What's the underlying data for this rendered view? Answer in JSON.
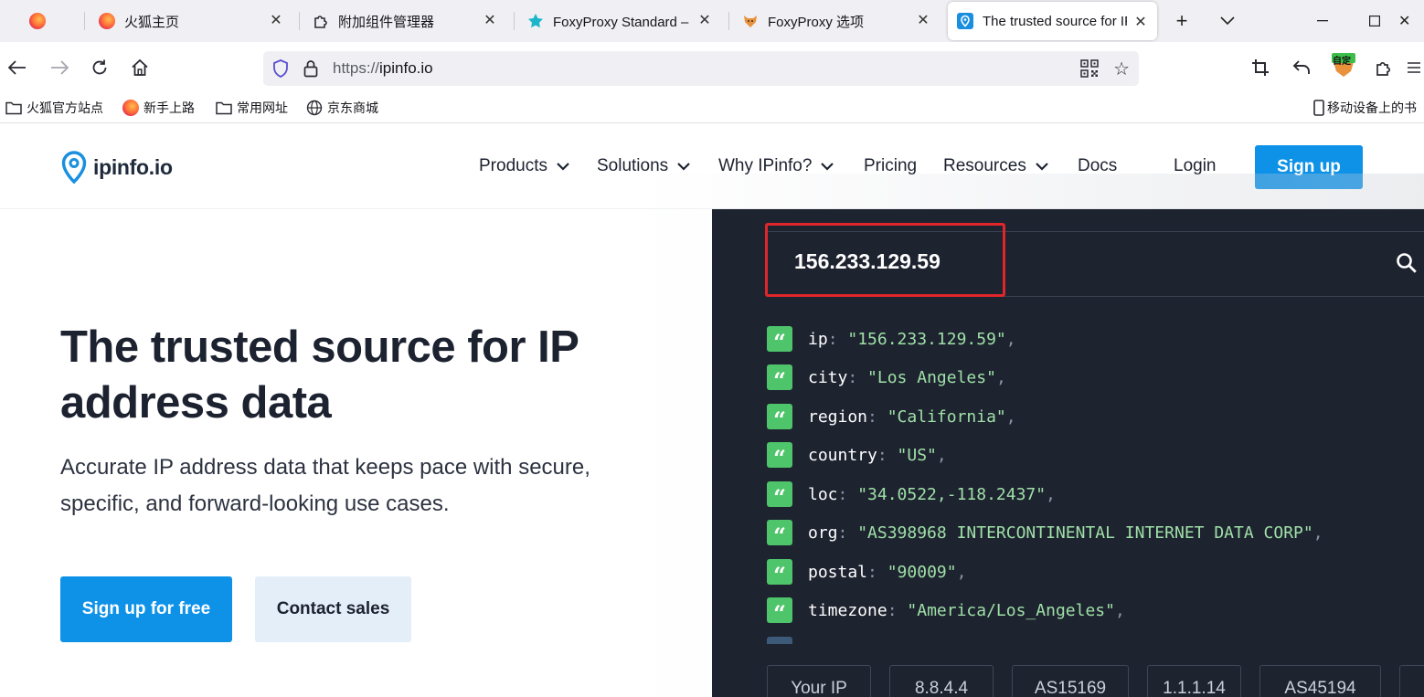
{
  "browser": {
    "tabs": [
      {
        "label": "",
        "icon": "firefox-icon"
      },
      {
        "label": "火狐主页",
        "icon": "firefox-icon"
      },
      {
        "label": "附加组件管理器",
        "icon": "puzzle-icon"
      },
      {
        "label": "FoxyProxy Standard – 「",
        "icon": "foxyproxy-icon"
      },
      {
        "label": "FoxyProxy 选项",
        "icon": "foxyproxy-fox-icon"
      },
      {
        "label": "The trusted source for IP",
        "icon": "ipinfo-icon",
        "active": true
      }
    ],
    "url_scheme": "https://",
    "url_host": "ipinfo.io",
    "bookmarks": [
      {
        "label": "火狐官方站点",
        "icon": "folder-icon"
      },
      {
        "label": "新手上路",
        "icon": "firefox-icon"
      },
      {
        "label": "常用网址",
        "icon": "folder-icon"
      },
      {
        "label": "京东商城",
        "icon": "globe-icon"
      },
      {
        "label": "移动设备上的书",
        "icon": "mobile-icon"
      }
    ],
    "extension_badge": "自定"
  },
  "site": {
    "logo_text": "ipinfo.io",
    "nav": {
      "products": "Products",
      "solutions": "Solutions",
      "why": "Why IPinfo?",
      "pricing": "Pricing",
      "resources": "Resources",
      "docs": "Docs",
      "login": "Login",
      "signup": "Sign up"
    },
    "hero": {
      "title": "The trusted source for IP address data",
      "subtitle": "Accurate IP address data that keeps pace with secure, specific, and forward-looking use cases.",
      "cta_primary": "Sign up for free",
      "cta_secondary": "Contact sales"
    },
    "demo": {
      "search_value": "156.233.129.59",
      "rows": [
        {
          "key": "ip",
          "value": "\"156.233.129.59\""
        },
        {
          "key": "city",
          "value": "\"Los Angeles\""
        },
        {
          "key": "region",
          "value": "\"California\""
        },
        {
          "key": "country",
          "value": "\"US\""
        },
        {
          "key": "loc",
          "value": "\"34.0522,-118.2437\""
        },
        {
          "key": "org",
          "value": "\"AS398968 INTERCONTINENTAL INTERNET DATA CORP\""
        },
        {
          "key": "postal",
          "value": "\"90009\""
        },
        {
          "key": "timezone",
          "value": "\"America/Los_Angeles\""
        }
      ],
      "chips": [
        "Your IP",
        "8.8.4.4",
        "AS15169",
        "1.1.1.14",
        "AS45194"
      ]
    },
    "colors": {
      "primary": "#0d92e8",
      "panel": "#1e2330",
      "json_value": "#9fe0a7",
      "badge": "#4fc56b",
      "highlight": "#e0262b"
    }
  }
}
